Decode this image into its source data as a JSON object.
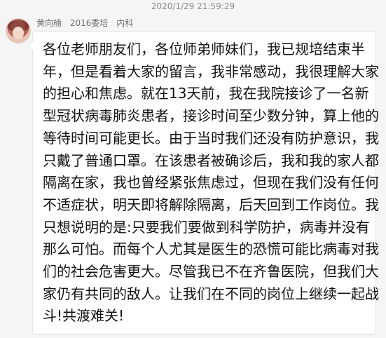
{
  "timestamp": "2020/1/29 21:59:29",
  "sender": {
    "name": "黄向楠",
    "group": "2016委培",
    "department": "内科",
    "avatar_icon": "user-avatar"
  },
  "message": {
    "lines": [
      "各位老师朋友们，各位师弟师妹们，我已规培结束半",
      "年，但是看着大家的留言，我非常感动，我很理解大家",
      "的担心和焦虑。就在13天前，我在我院接诊了一名新",
      "型冠状病毒肺炎患者，接诊时间至少数分钟，算上他的",
      "等待时间可能更长。由于当时我们还没有防护意识，我",
      "只戴了普通口罩。在该患者被确诊后，我和我的家人都",
      "隔离在家，我也曾经紧张焦虑过，但现在我们没有任何",
      "不适症状，明天即将解除隔离，后天回到工作岗位。我",
      "只想说明的是:只要我们要做到科学防护，病毒并没有",
      "那么可怕。而每个人尤其是医生的恐慌可能比病毒对我",
      "们的社会危害更大。尽管我已不在齐鲁医院，但我们大",
      "家仍有共同的敌人。让我们在不同的岗位上继续一起战",
      "斗!共渡难关!"
    ]
  },
  "colors": {
    "background": "#f5f5f5",
    "bubble": "#ffffff",
    "meta_text": "#8a8a8a",
    "message_text": "#111111"
  }
}
